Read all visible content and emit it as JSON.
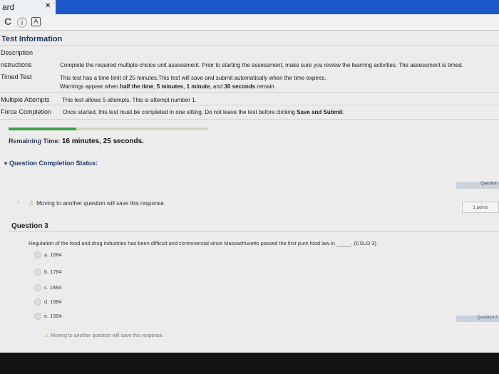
{
  "browser": {
    "tab_title": "ard",
    "tab_close": "×"
  },
  "test_info": {
    "title": "Test Information",
    "rows": [
      {
        "label": "Description",
        "value": ""
      },
      {
        "label": "nstructions",
        "value": "Complete the required multiple-choice unit assessment. Prior to starting the assessment, make sure you review the learning activities. The assessment is timed."
      },
      {
        "label": "Timed Test",
        "value": "This test has a time limit of 25 minutes.This test will save and submit automatically when the time expires.",
        "value2_pre": "Warnings appear when ",
        "value2_b1": "half the time",
        "value2_m1": ", ",
        "value2_b2": "5 minutes",
        "value2_m2": ", ",
        "value2_b3": "1 minute",
        "value2_m3": ", and ",
        "value2_b4": "30 seconds",
        "value2_post": " remain."
      },
      {
        "label": "Multiple Attempts",
        "value": "This test allows 5 attempts. This is attempt number 1."
      },
      {
        "label": "Force Completion",
        "value_pre": "Once started, this test must be completed in one sitting. Do not leave the test before clicking ",
        "value_b": "Save and Submit",
        "value_post": "."
      }
    ]
  },
  "timer": {
    "label": "Remaining Time:",
    "value": "16 minutes, 25 seconds.",
    "progress": 0.34
  },
  "status": {
    "label": "Question Completion Status:"
  },
  "notices": {
    "save_note": "Moving to another question will save this response.",
    "question_right": "Question",
    "question_footer": "Question 3"
  },
  "question": {
    "number_label": "Question 3",
    "points": "1 points",
    "text": "Regulation of the food and drug industries has been difficult and controversial since Massachusetts passed the first pure food law in _____. (CSLO 3)",
    "options": [
      "a. 1684",
      "b. 1784",
      "c. 1884",
      "d. 1984",
      "e. 1994"
    ]
  },
  "colors": {
    "tab_bar": "#1e57c8",
    "progress_fill": "#3ea04a",
    "heading": "#1d3a66"
  }
}
